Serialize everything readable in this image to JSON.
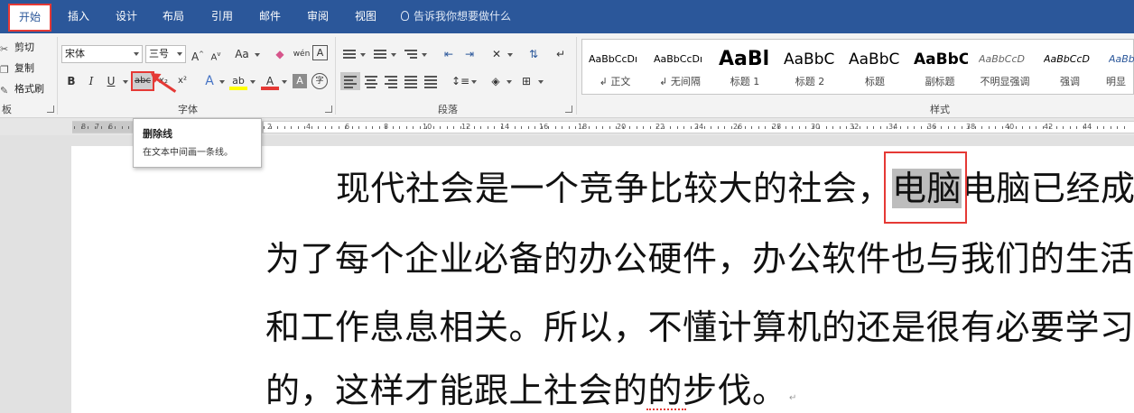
{
  "tabs": {
    "home": "开始",
    "insert": "插入",
    "design": "设计",
    "layout": "布局",
    "references": "引用",
    "mailings": "邮件",
    "review": "审阅",
    "view": "视图"
  },
  "tell_me": "告诉我你想要做什么",
  "clipboard": {
    "cut": "剪切",
    "copy": "复制",
    "format_painter": "格式刷",
    "label": "板"
  },
  "font": {
    "name": "宋体",
    "size": "三号",
    "grow": "A",
    "shrink": "A",
    "case": "Aa",
    "clear": "◆",
    "pinyin": "wén",
    "border_char": "A",
    "bold": "B",
    "italic": "I",
    "underline": "U",
    "strikethrough": "abc",
    "subscript": "x₂",
    "superscript": "x²",
    "effects": "A",
    "highlight": "ab",
    "color": "A",
    "shading": "A",
    "enclose": "字",
    "label": "字体"
  },
  "paragraph": {
    "label": "段落"
  },
  "styles": {
    "label": "样式",
    "items": [
      {
        "sample": "AaBbCcDı",
        "name": "正文"
      },
      {
        "sample": "AaBbCcDı",
        "name": "无间隔"
      },
      {
        "sample": "AaBl",
        "name": "标题 1"
      },
      {
        "sample": "AaBbC",
        "name": "标题 2"
      },
      {
        "sample": "AaBbC",
        "name": "标题"
      },
      {
        "sample": "AaBbC",
        "name": "副标题"
      },
      {
        "sample": "AaBbCcD",
        "name": "不明显强调"
      },
      {
        "sample": "AaBbCcD",
        "name": "强调"
      },
      {
        "sample": "AaBb",
        "name": "明显"
      }
    ]
  },
  "ruler": {
    "left_numbers": [
      "8",
      "7",
      "6"
    ],
    "right_numbers": [
      "2",
      "4",
      "6",
      "8",
      "10",
      "12",
      "14",
      "16",
      "18",
      "20",
      "22",
      "24",
      "26",
      "28",
      "30",
      "32",
      "34",
      "36",
      "38",
      "40",
      "42",
      "44"
    ]
  },
  "tooltip": {
    "title": "删除线",
    "description": "在文本中间画一条线。"
  },
  "document": {
    "line1_before": "现代社会是一个竞争比较大的社会，",
    "line1_selected": "电脑",
    "line1_after": "电脑已经成",
    "line2": "为了每个企业必备的办公硬件，办公软件也与我们的生活",
    "line3": "和工作息息相关。所以，不懂计算机的还是很有必要学习",
    "line4": "的，这样才能跟上社会的的步伐。",
    "para_mark": "↵"
  },
  "colors": {
    "ribbon_blue": "#2b579a",
    "annotation_red": "#e53935",
    "selection_grey": "#bdbdbd"
  }
}
